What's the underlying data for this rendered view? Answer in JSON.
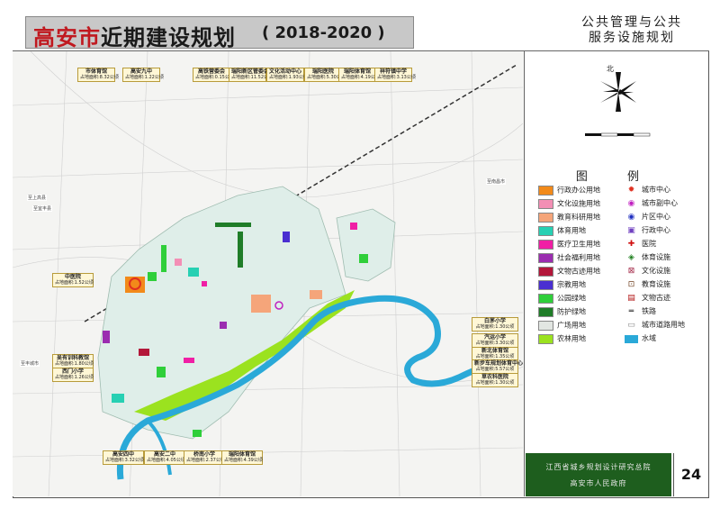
{
  "header": {
    "title_city": "高安市",
    "title_rest": "近期建设规划",
    "title_year": "( 2018-2020 )",
    "subtitle_line1": "公共管理与公共",
    "subtitle_line2": "服务设施规划"
  },
  "north": {
    "label": "北"
  },
  "legend": {
    "title": "图 例",
    "items_left": [
      {
        "label": "行政办公用地",
        "color": "#f28a1a"
      },
      {
        "label": "文化设施用地",
        "color": "#f38fb5"
      },
      {
        "label": "教育科研用地",
        "color": "#f5a57a"
      },
      {
        "label": "体育用地",
        "color": "#27d0b3"
      },
      {
        "label": "医疗卫生用地",
        "color": "#f01fa5"
      },
      {
        "label": "社会福利用地",
        "color": "#9b2db0"
      },
      {
        "label": "文物古迹用地",
        "color": "#b3173a"
      },
      {
        "label": "宗教用地",
        "color": "#4a2fd1"
      },
      {
        "label": "公园绿地",
        "color": "#2fcf3a"
      },
      {
        "label": "防护绿地",
        "color": "#1f7d28"
      },
      {
        "label": "广场用地",
        "color": "#e2e6e2"
      },
      {
        "label": "农林用地",
        "color": "#9be21f"
      }
    ],
    "items_right": [
      {
        "label": "城市中心",
        "icon": "city-center-icon"
      },
      {
        "label": "城市副中心",
        "icon": "sub-center-icon"
      },
      {
        "label": "片区中心",
        "icon": "district-center-icon"
      },
      {
        "label": "行政中心",
        "icon": "admin-center-icon"
      },
      {
        "label": "医院",
        "icon": "hospital-icon"
      },
      {
        "label": "体育设施",
        "icon": "sports-facility-icon"
      },
      {
        "label": "文化设施",
        "icon": "culture-facility-icon"
      },
      {
        "label": "教育设施",
        "icon": "education-facility-icon"
      },
      {
        "label": "文物古迹",
        "icon": "heritage-icon"
      },
      {
        "label": "铁路",
        "icon": "railway-icon"
      },
      {
        "label": "城市道路用地",
        "icon": "road-icon"
      },
      {
        "label": "水域",
        "icon": "water-icon",
        "color": "#2aa9d8"
      }
    ]
  },
  "footer": {
    "line1": "江西省城乡规划设计研究总院",
    "line2": "高安市人民政府",
    "page": "24"
  },
  "map": {
    "colors": {
      "river": "#2aa9d8",
      "farmland": "#9be21f",
      "park": "#2fcf3a",
      "urban": "#dfeee9"
    },
    "top_tags": [
      {
        "name": "市体育馆",
        "sub": "占地面积:8.32公顷"
      },
      {
        "name": "高安九中",
        "sub": "占地面积:1.22公顷"
      },
      {
        "name": "高铁营委会",
        "sub": "占地面积:0.15公顷"
      },
      {
        "name": "瑞阳新区管委会",
        "sub": "占地面积:11.52公顷"
      },
      {
        "name": "文化活动中心",
        "sub": "占地面积:1.93公顷"
      },
      {
        "name": "瑞阳医院",
        "sub": "占地面积:5.30公顷"
      },
      {
        "name": "瑞阳体育馆",
        "sub": "占地面积:4.19公顷"
      },
      {
        "name": "祥符镇中学",
        "sub": "占地面积:3.13公顷"
      }
    ],
    "left_tags": [
      {
        "name": "中医院",
        "sub": "占地面积:1.52公顷"
      },
      {
        "name": "吴有训科教馆",
        "sub": "占地面积:1.80公顷"
      },
      {
        "name": "西门小学",
        "sub": "占地面积:1.26公顷"
      }
    ],
    "right_tags": [
      {
        "name": "白茅小学",
        "sub": "占地面积:1.30公顷"
      },
      {
        "name": "汽运小学",
        "sub": "占地面积:3.30公顷"
      },
      {
        "name": "新北体育馆",
        "sub": "占地面积:1.35公顷"
      },
      {
        "name": "新步车规划体育中心",
        "sub": "占地面积:5.57公顷"
      },
      {
        "name": "草农科医院",
        "sub": "占地面积:1.30公顷"
      }
    ],
    "bottom_tags": [
      {
        "name": "高安四中",
        "sub": "占地面积:3.32公顷"
      },
      {
        "name": "高安二中",
        "sub": "占地面积:4.05公顷"
      },
      {
        "name": "桥南小学",
        "sub": "占地面积:2.37公顷"
      },
      {
        "name": "瑞阳体育馆",
        "sub": "占地面积:4.39公顷"
      }
    ],
    "place_labels": [
      {
        "text": "至上高县"
      },
      {
        "text": "至宜丰县"
      },
      {
        "text": "至丰城市"
      },
      {
        "text": "至南昌市"
      }
    ]
  }
}
